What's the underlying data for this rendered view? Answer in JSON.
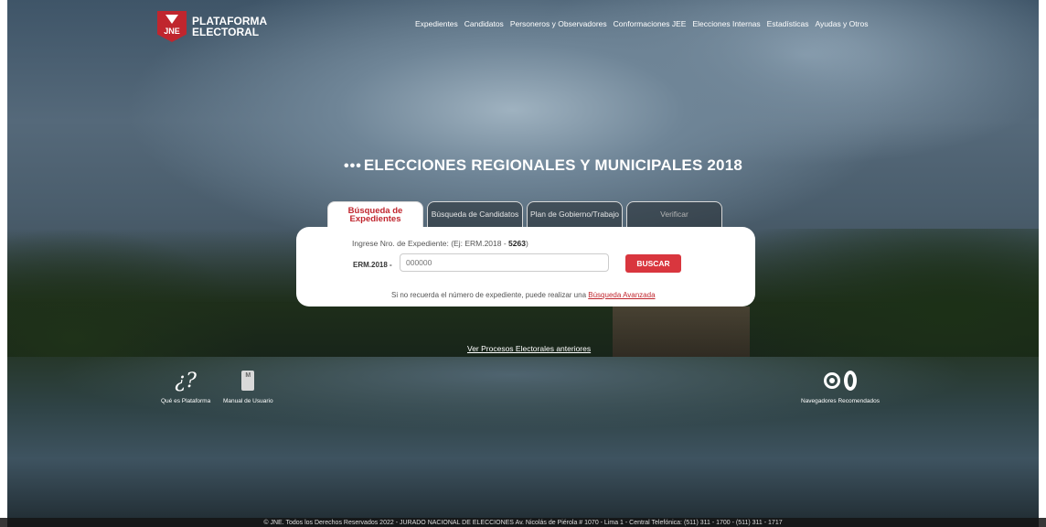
{
  "brand": {
    "line1": "PLATAFORMA",
    "line2": "ELECTORAL",
    "shield_text": "JNE"
  },
  "nav": {
    "items": [
      "Expedientes",
      "Candidatos",
      "Personeros y Observadores",
      "Conformaciones JEE",
      "Elecciones Internas",
      "Estadísticas",
      "Ayudas y Otros"
    ]
  },
  "headline": {
    "dots": "•••",
    "text": "ELECCIONES REGIONALES Y MUNICIPALES 2018"
  },
  "tabs": [
    {
      "label": "Búsqueda de Expedientes",
      "active": true
    },
    {
      "label": "Búsqueda de Candidatos",
      "active": false
    },
    {
      "label": "Plan de Gobierno/Trabajo",
      "active": false
    },
    {
      "label": "Verificar",
      "active": false
    }
  ],
  "search": {
    "hint_prefix": "Ingrese Nro. de Expediente: (Ej: ERM.2018 - ",
    "hint_example": "5263",
    "hint_suffix": ")",
    "field_prefix": "ERM.2018 -",
    "placeholder": "000000",
    "button_label": "BUSCAR",
    "advanced_text": "Si no recuerda el número de expediente, puede realizar una ",
    "advanced_link": "Búsqueda Avanzada"
  },
  "previous_link": "Ver Procesos Electorales anteriores",
  "help": {
    "about_label": "Qué es Plataforma",
    "about_icon": "question-icon",
    "manual_label": "Manual de Usuario",
    "manual_icon_text": "M",
    "browsers_label": "Navegadores Recomendados"
  },
  "footer": "© JNE. Todos los Derechos Reservados 2022 - JURADO NACIONAL DE ELECCIONES Av. Nicolás de Piérola # 1070 - Lima 1 - Central Telefónica: (511) 311 - 1700 - (511) 311 - 1717",
  "colors": {
    "accent": "#c0262e",
    "button": "#d9363e"
  }
}
